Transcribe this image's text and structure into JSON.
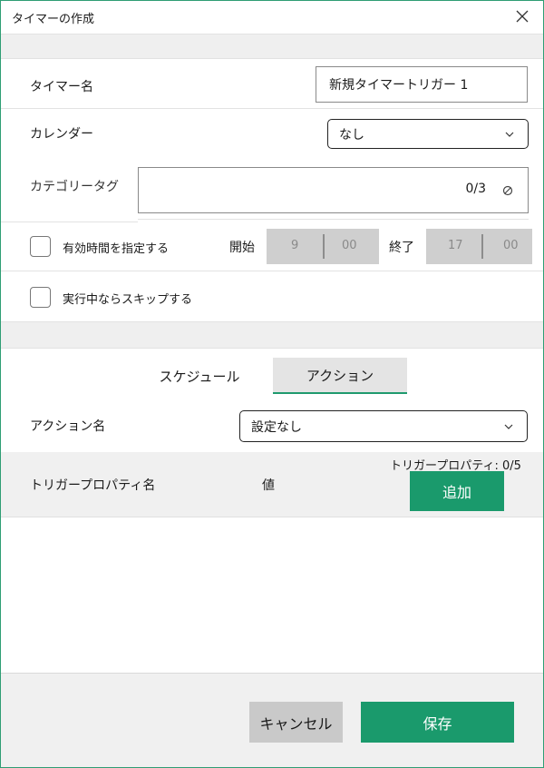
{
  "window": {
    "title": "タイマーの作成",
    "close_icon": "close-icon"
  },
  "form": {
    "timer_name_label": "タイマー名",
    "timer_name_value": "新規タイマートリガー 1",
    "calendar_label": "カレンダー",
    "calendar_value": "なし",
    "category_tag_label": "カテゴリータグ",
    "category_tag_count": "0/3",
    "valid_time_label": "有効時間を指定する",
    "valid_time_checked": false,
    "start_label": "開始",
    "start_hour": "9",
    "start_minute": "00",
    "end_label": "終了",
    "end_hour": "17",
    "end_minute": "00",
    "skip_running_label": "実行中ならスキップする",
    "skip_running_checked": false
  },
  "tabs": [
    {
      "label": "スケジュール",
      "active": false
    },
    {
      "label": "アクション",
      "active": true
    }
  ],
  "action": {
    "action_name_label": "アクション名",
    "action_name_value": "設定なし",
    "property_count": "トリガープロパティ: 0/5",
    "col_property_name": "トリガープロパティ名",
    "col_value": "値",
    "add_label": "追加"
  },
  "footer": {
    "cancel_label": "キャンセル",
    "save_label": "保存"
  },
  "colors": {
    "accent": "#1a9a6c",
    "border": "#2f9e74"
  }
}
